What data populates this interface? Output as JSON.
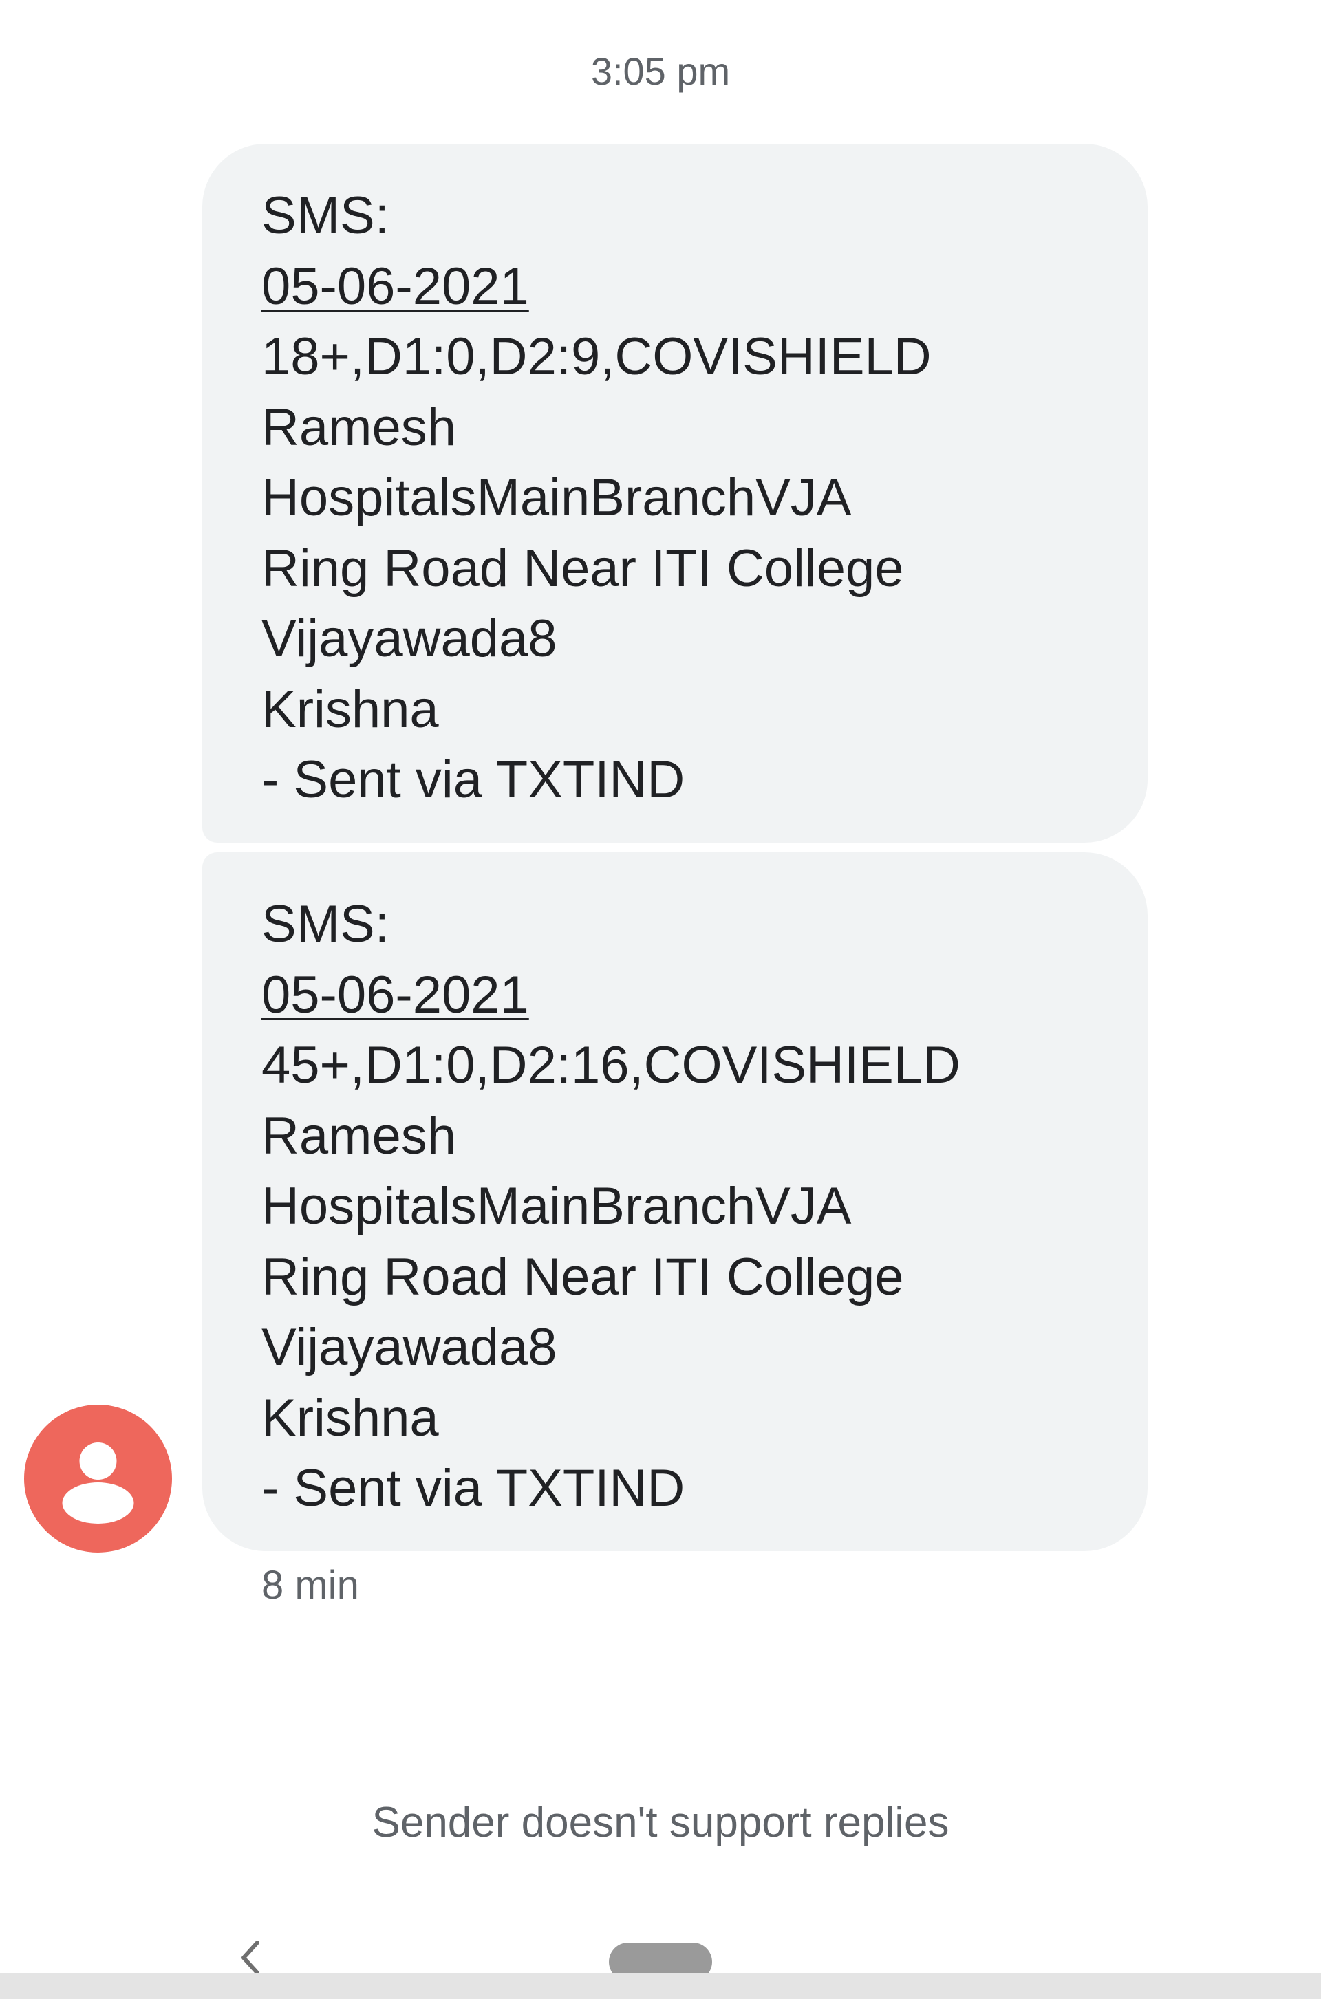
{
  "conversation": {
    "timestamp": "3:05 pm",
    "messages": [
      {
        "lines": [
          "SMS:",
          "05-06-2021",
          "18+,D1:0,D2:9,COVISHIELD",
          "Ramesh",
          "HospitalsMainBranchVJA",
          "Ring Road Near ITI College",
          "Vijayawada8",
          "Krishna",
          "- Sent via TXTIND"
        ]
      },
      {
        "lines": [
          "SMS:",
          "05-06-2021",
          "45+,D1:0,D2:16,COVISHIELD",
          "Ramesh",
          "HospitalsMainBranchVJA",
          "Ring Road Near ITI College",
          "Vijayawada8",
          "Krishna",
          "- Sent via TXTIND"
        ]
      }
    ],
    "elapsed": "8 min",
    "avatar_icon": "person-icon",
    "avatar_color": "#ee675c",
    "bubble_color": "#f1f3f4"
  },
  "footer": {
    "notice": "Sender doesn't support replies"
  },
  "navigation": {
    "back_icon": "chevron-left-icon",
    "home_icon": "home-pill-icon"
  }
}
